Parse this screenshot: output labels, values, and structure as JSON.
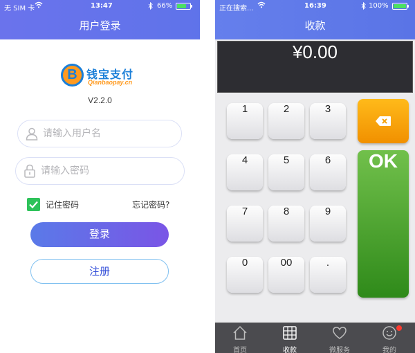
{
  "login_screen": {
    "status_bar": {
      "carrier": "无 SIM 卡",
      "time": "13:47",
      "battery_text": "66%",
      "battery_level": 0.66
    },
    "title": "用户登录",
    "logo": {
      "name": "钱宝支付",
      "domain": "Qianbaopay.cn",
      "badge_letter": "B"
    },
    "version": "V2.2.0",
    "username": {
      "placeholder": "请输入用户名",
      "value": "",
      "icon": "user-icon"
    },
    "password": {
      "placeholder": "请输入密码",
      "value": "",
      "icon": "lock-icon"
    },
    "remember": {
      "label": "记住密码",
      "checked": true
    },
    "forgot_label": "忘记密码?",
    "login_label": "登录",
    "register_label": "注册"
  },
  "payment_screen": {
    "status_bar": {
      "carrier": "正在搜索...",
      "time": "16:39",
      "battery_text": "100%",
      "battery_level": 1.0
    },
    "title": "收款",
    "amount": "¥0.00",
    "keys": [
      "1",
      "2",
      "3",
      "4",
      "5",
      "6",
      "7",
      "8",
      "9",
      "0",
      "00",
      "."
    ],
    "backspace_icon": "backspace-icon",
    "ok_label": "OK",
    "tabs": [
      {
        "label": "首页",
        "icon": "home-icon",
        "active": false
      },
      {
        "label": "收款",
        "icon": "calculator-icon",
        "active": true
      },
      {
        "label": "微服务",
        "icon": "heart-icon",
        "active": false
      },
      {
        "label": "我的",
        "icon": "smiley-icon",
        "active": false,
        "badge": true
      }
    ]
  },
  "colors": {
    "header_blue": "#6a73ec",
    "accent_purple": "#7a55e6",
    "success_green": "#2ec25a",
    "warning_orange": "#f5a20c",
    "ok_green": "#3d9a22"
  }
}
